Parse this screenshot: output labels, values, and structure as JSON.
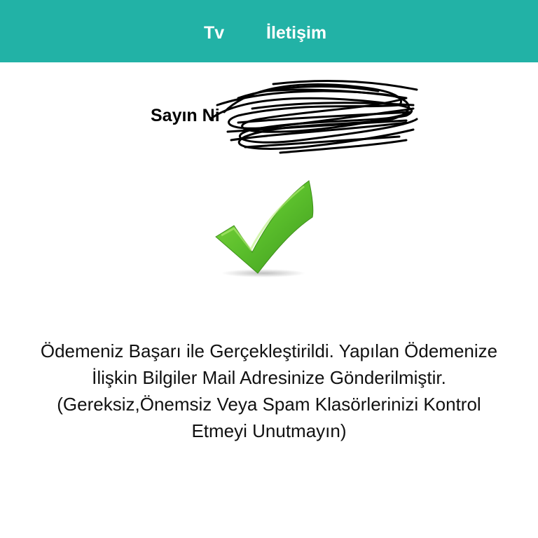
{
  "nav": {
    "items": [
      {
        "label": "Tv"
      },
      {
        "label": "İletişim"
      }
    ]
  },
  "greeting": {
    "salutation": "Sayın Ni"
  },
  "status": {
    "icon": "checkmark-icon",
    "color": "#5bbf2c"
  },
  "message": {
    "lines": [
      "Ödemeniz Başarı ile Gerçekleştirildi. Yapılan Ödemenize",
      "İlişkin Bilgiler Mail Adresinize Gönderilmiştir.",
      "(Gereksiz,Önemsiz Veya Spam Klasörlerinizi Kontrol",
      "Etmeyi Unutmayın)"
    ]
  },
  "theme": {
    "header_color": "#22b2a6"
  }
}
